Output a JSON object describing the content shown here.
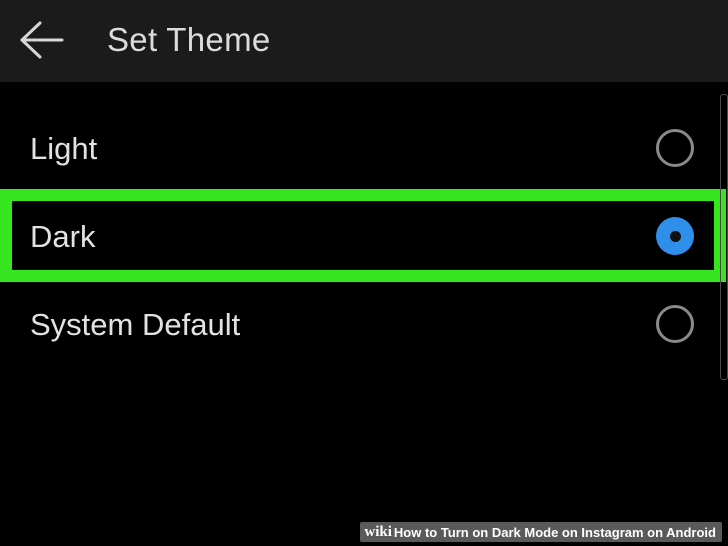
{
  "header": {
    "title": "Set Theme",
    "back_icon": "arrow-left-icon"
  },
  "options": [
    {
      "label": "Light",
      "selected": false
    },
    {
      "label": "Dark",
      "selected": true
    },
    {
      "label": "System Default",
      "selected": false
    }
  ],
  "colors": {
    "highlight": "#35e61e",
    "radio_selected": "#2e8ee9",
    "topbar": "#1b1b1b",
    "background": "#000000"
  },
  "watermark": {
    "brand": "wiki",
    "text": "How to Turn on Dark Mode on Instagram on Android"
  }
}
